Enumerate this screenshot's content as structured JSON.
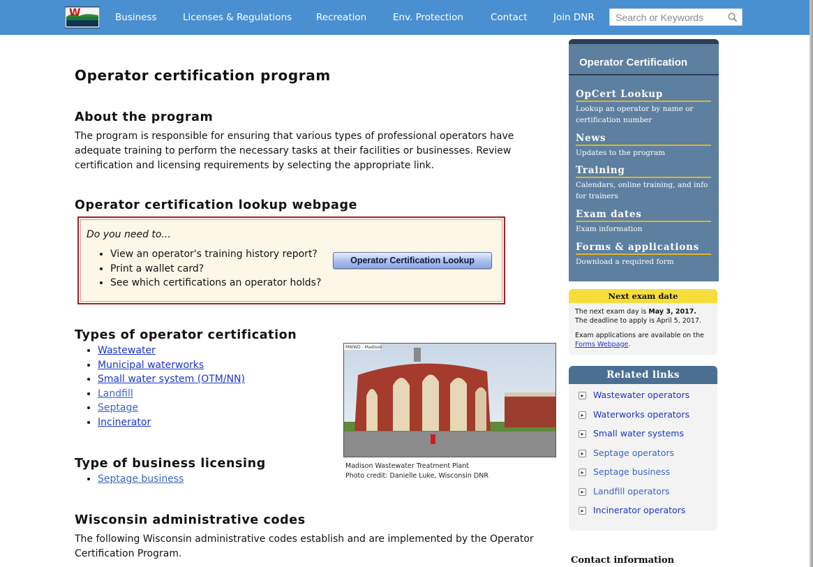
{
  "nav": {
    "items": [
      "Business",
      "Licenses & Regulations",
      "Recreation",
      "Env. Protection",
      "Contact",
      "Join DNR"
    ],
    "search_placeholder": "Search or Keywords",
    "bar_color": "#4a8fd0"
  },
  "page_title": "Operator certification program",
  "about": {
    "heading": "About the program",
    "text": "The program is responsible for ensuring that various types of professional operators have adequate training to perform the necessary tasks at their facilities or businesses. Review certification and licensing requirements by selecting the appropriate link."
  },
  "lookup": {
    "heading": "Operator certification lookup webpage",
    "question": "Do you need to...",
    "bullets": [
      "View an operator's training history report?",
      "Print a wallet card?",
      "See which certifications an operator holds?"
    ],
    "button_label": "Operator Certification Lookup"
  },
  "types": {
    "heading": "Types of operator certification",
    "items": [
      "Wastewater",
      "Municipal waterworks",
      "Small water system (OTM/NN)",
      "Landfill",
      "Septage",
      "Incinerator"
    ]
  },
  "photo": {
    "stamp": "MWWD - Madison",
    "caption_line1": "Madison Wastewater Treatment Plant",
    "caption_line2": "Photo credit: Danielle Luke, Wisconsin DNR"
  },
  "business": {
    "heading": "Type of business licensing",
    "items": [
      "Septage business"
    ]
  },
  "codes": {
    "heading": "Wisconsin administrative codes",
    "text": "The following Wisconsin administrative codes establish and are implemented by the Operator Certification Program."
  },
  "sidebar": {
    "title": "Operator Certification",
    "items": [
      {
        "heading": "OpCert Lookup",
        "sub": "Lookup an operator by name or certification number"
      },
      {
        "heading": "News",
        "sub": "Updates to the program"
      },
      {
        "heading": "Training",
        "sub": "Calendars, online training, and info for trainers"
      },
      {
        "heading": "Exam dates",
        "sub": "Exam information"
      },
      {
        "heading": "Forms & applications",
        "sub": "Download a required form"
      }
    ]
  },
  "exam": {
    "header": "Next exam date",
    "line1_prefix": "The next exam day is ",
    "line1_date": "May 3, 2017.",
    "line2": "The deadline to apply is April 5, 2017.",
    "line3": "Exam applications are available on the",
    "link": "Forms Webpage",
    "link_suffix": "."
  },
  "related": {
    "header": "Related links",
    "items": [
      "Wastewater operators",
      "Waterworks operators",
      "Small water systems",
      "Septage operators",
      "Septage business",
      "Landfill operators",
      "Incinerator operators"
    ]
  },
  "contact_heading": "Contact information"
}
